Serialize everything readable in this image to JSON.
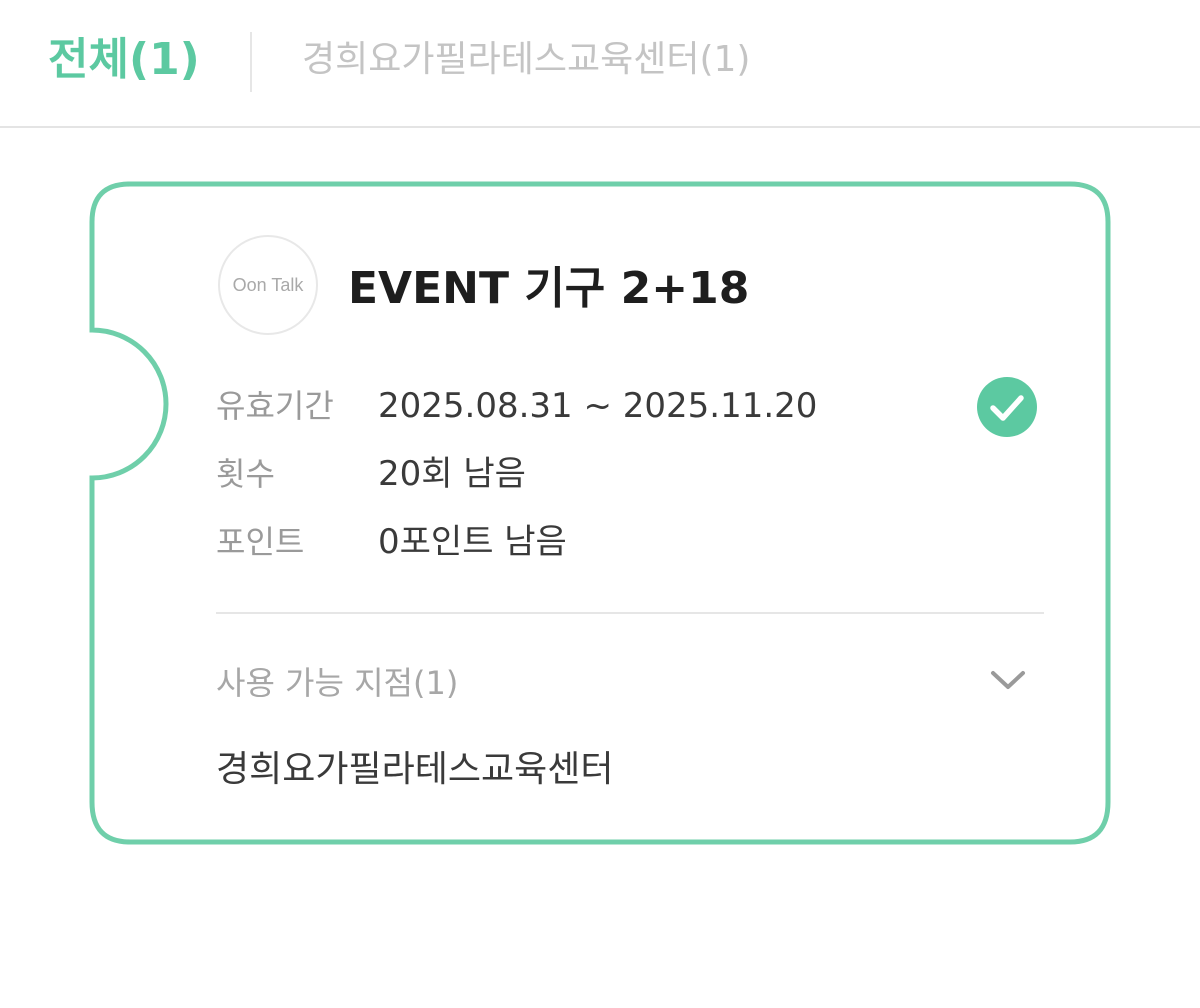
{
  "tabs": {
    "all_label": "전체(1)",
    "center_label": "경희요가필라테스교육센터(1)"
  },
  "ticket": {
    "logo_text": "Oon Talk",
    "title": "EVENT 기구 2+18",
    "rows": [
      {
        "label": "유효기간",
        "value": "2025.08.31 ~ 2025.11.20"
      },
      {
        "label": "횟수",
        "value": "20회 남음"
      },
      {
        "label": "포인트",
        "value": "0포인트 남음"
      }
    ],
    "branches_label": "사용 가능 지점(1)",
    "branch_name": "경희요가필라테스교육센터"
  },
  "icons": {
    "check": "check-circle-icon",
    "chevron": "chevron-down-icon"
  },
  "colors": {
    "accent": "#5cc9a1",
    "text_dark": "#1e1e1e",
    "text_muted": "#9a9a9a",
    "divider": "#e6e6e6"
  }
}
